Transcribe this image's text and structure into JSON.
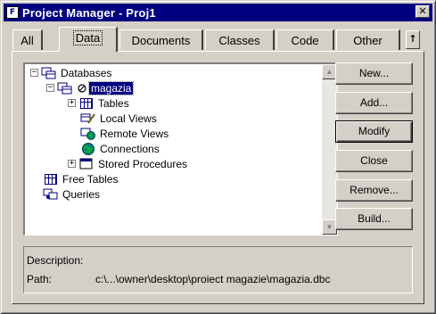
{
  "window": {
    "title": "Project Manager - Proj1",
    "icon": "foxpro-project-icon",
    "close_glyph": "✕"
  },
  "tabs": [
    {
      "label": "All"
    },
    {
      "label": "Data",
      "active": true
    },
    {
      "label": "Documents"
    },
    {
      "label": "Classes"
    },
    {
      "label": "Code"
    },
    {
      "label": "Other"
    }
  ],
  "tab_scroll_glyph": "↑",
  "tree": {
    "items": [
      {
        "label": "Databases",
        "icon": "databases-icon",
        "expander": "−"
      },
      {
        "label": "magazia",
        "icon": "database-icon",
        "expander": "−",
        "selected": true
      },
      {
        "label": "Tables",
        "icon": "tables-icon",
        "expander": "+"
      },
      {
        "label": "Local Views",
        "icon": "local-views-icon"
      },
      {
        "label": "Remote Views",
        "icon": "remote-views-icon"
      },
      {
        "label": "Connections",
        "icon": "connections-icon"
      },
      {
        "label": "Stored Procedures",
        "icon": "stored-procedures-icon",
        "expander": "+"
      },
      {
        "label": "Free Tables",
        "icon": "free-tables-icon"
      },
      {
        "label": "Queries",
        "icon": "queries-icon"
      }
    ],
    "scroll_up_glyph": "▲",
    "scroll_down_glyph": "▼"
  },
  "buttons": {
    "new": "New...",
    "add": "Add...",
    "modify": "Modify",
    "close": "Close",
    "remove": "Remove...",
    "build": "Build..."
  },
  "description": {
    "description_label": "Description:",
    "path_label": "Path:",
    "path_value": "c:\\...\\owner\\desktop\\proiect magazie\\magazia.dbc"
  },
  "colors": {
    "titlebar": "#000080",
    "face": "#d4d0c8",
    "selection": "#000080"
  }
}
